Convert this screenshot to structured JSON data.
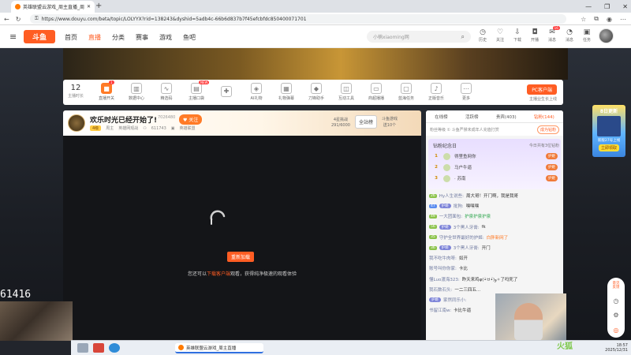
{
  "browser": {
    "tab_title": "英雄联盟云游戏_周主直播_周主直播",
    "url": "https://www.douyu.com/beta/topic/LOLYYX?rid=138243&dyshid=5adb4c-66b6d837b7f45efcbfdc850400071701"
  },
  "header": {
    "logo_text": "斗鱼",
    "nav": [
      "首页",
      "直播",
      "分类",
      "赛事",
      "游戏",
      "鱼吧"
    ],
    "active_nav": "直播",
    "search_placeholder": "小楠xiaoming网",
    "icons": [
      {
        "label": "历史",
        "icon": "clock-icon",
        "glyph": "◷"
      },
      {
        "label": "关注",
        "icon": "heart-icon",
        "glyph": "♡"
      },
      {
        "label": "下载",
        "icon": "download-icon",
        "glyph": "⇩"
      },
      {
        "label": "开播",
        "icon": "camera-icon",
        "glyph": "◘"
      },
      {
        "label": "消息",
        "icon": "message-icon",
        "glyph": "✉",
        "badge": "16"
      },
      {
        "label": "消息",
        "icon": "bell-icon",
        "glyph": "◔"
      },
      {
        "label": "任务",
        "icon": "gift-icon",
        "glyph": "▣",
        "badge": ""
      }
    ]
  },
  "toolbar": {
    "first": {
      "number": "12",
      "label": "主播时长"
    },
    "items": [
      {
        "label": "直播开关",
        "icon": "toggle-icon",
        "glyph": "■",
        "accent": true,
        "badge": "1"
      },
      {
        "label": "数据中心",
        "icon": "chart-icon",
        "glyph": "▥"
      },
      {
        "label": "精选码",
        "icon": "wave-icon",
        "glyph": "∿"
      },
      {
        "label": "主播口袋",
        "icon": "pocket-icon",
        "glyph": "▤",
        "badge": "NEW"
      },
      {
        "label": "",
        "icon": "gift-icon",
        "glyph": "✚"
      },
      {
        "label": "AI礼物",
        "icon": "ai-gift-icon",
        "glyph": "◈"
      },
      {
        "label": "礼物弹幕",
        "icon": "gift-barrage-icon",
        "glyph": "▦"
      },
      {
        "label": "刀锋助手",
        "icon": "shield-icon",
        "glyph": "◆"
      },
      {
        "label": "互动工具",
        "icon": "tools-icon",
        "glyph": "◫"
      },
      {
        "label": "商超播播",
        "icon": "shop-icon",
        "glyph": "▭"
      },
      {
        "label": "蓝海任务",
        "icon": "ad-icon",
        "glyph": "▢"
      },
      {
        "label": "正版音乐",
        "icon": "music-icon",
        "glyph": "♪"
      },
      {
        "label": "更多",
        "icon": "more-icon",
        "glyph": "⋯"
      }
    ],
    "pc_client_label": "PC客户端",
    "pc_client_sub": "主播业生长上线"
  },
  "streamer": {
    "title": "欢乐时光已经开始了!",
    "heat": "7026480",
    "follow_label": "关注",
    "level": "4级",
    "owner_label": "周主",
    "category": "英雄网观战",
    "fans": "611743",
    "game": "英雄联盟",
    "rank_box": {
      "line1": "4星挑战",
      "line2": "291/6000"
    },
    "all_station_label": "全站榜",
    "game_box": {
      "line1": "斗鱼游戏",
      "line2": "送10个"
    }
  },
  "video": {
    "reload_label": "重新加载",
    "tip_prefix": "您还可以",
    "tip_link": "下载客户端",
    "tip_suffix": "观看，获得纯净极速的观看体验"
  },
  "panel": {
    "tabs": [
      "在线榜",
      "活跃榜",
      "贵宾(403)",
      "钻粉(144)"
    ],
    "active_tab": "钻粉(144)",
    "notice": "粉丝等级 ① 斗鱼严禁未成年人充值打赏",
    "notice_btn": "成为钻粉",
    "fans_header": "钻粉纪念日",
    "fans_header_right": "今日共有3位钻粉",
    "fans": [
      {
        "rank": "1",
        "name": "得里鱼网你",
        "medal": "护姬"
      },
      {
        "rank": "2",
        "name": "马户牛逼",
        "medal": "护姬"
      },
      {
        "rank": "3",
        "name": "· 苏南",
        "medal": "护姬"
      }
    ],
    "chat": [
      {
        "lv": "26",
        "lvtype": "g",
        "user": "Hy人生说些:",
        "text": "周大哥！开门啊，我是我哥",
        "tcolor": ""
      },
      {
        "lv": "47",
        "lvtype": "b",
        "medal": "护姬",
        "user": "批狗:",
        "text": "嘿嘿嘿",
        "tcolor": ""
      },
      {
        "lv": "49",
        "lvtype": "g",
        "medal": "",
        "user": "一大团面包:",
        "text": "护泉护泉护泉",
        "tcolor": "g"
      },
      {
        "lv": "56",
        "lvtype": "g",
        "medal": "护姬",
        "user": "3个黑人牙膏:",
        "text": "fk",
        "tcolor": ""
      },
      {
        "lv": "35",
        "lvtype": "g",
        "medal": "",
        "user": "守护全世界最好的护姬:",
        "text": "白胖新网了",
        "tcolor": "o"
      },
      {
        "lv": "36",
        "lvtype": "g",
        "medal": "护姬",
        "user": "3个黑人牙膏:",
        "text": "开门",
        "tcolor": ""
      },
      {
        "lv": "",
        "lvtype": "g",
        "medal": "",
        "user": "我不吃牛肉呀:",
        "text": "如开",
        "tcolor": ""
      },
      {
        "lv": "",
        "lvtype": "g",
        "medal": "",
        "user": "账号叫你你家:",
        "text": "卡比",
        "tcolor": ""
      },
      {
        "lv": "",
        "lvtype": "g",
        "medal": "",
        "user": "懂Luo渡海323:",
        "text": "昨天来鸡ψ(•̀ㅂ•́)و✧了吗死了",
        "tcolor": ""
      },
      {
        "lv": "",
        "lvtype": "g",
        "medal": "",
        "user": "我石数石头:",
        "text": "一二三四五...",
        "tcolor": ""
      },
      {
        "lv": "",
        "lvtype": "b",
        "medal": "护姬",
        "user": "家然同乐小:",
        "text": "",
        "tcolor": ""
      },
      {
        "lv": "",
        "lvtype": "g",
        "medal": "",
        "user": "书留江南w:",
        "text": "卡比牛逼",
        "tcolor": ""
      }
    ]
  },
  "promo": {
    "title": "8日更新",
    "desc": "新版27号上线",
    "button": "立即领取"
  },
  "overlay": {
    "counter": "61416",
    "watermark": "火狐"
  },
  "taskbar": {
    "window_label": "英雄联盟云游戏_周主直播",
    "time": "18:57",
    "date": "2025/12/31"
  },
  "colors": {
    "accent": "#ff5d23",
    "brand": "#ff7b27"
  }
}
